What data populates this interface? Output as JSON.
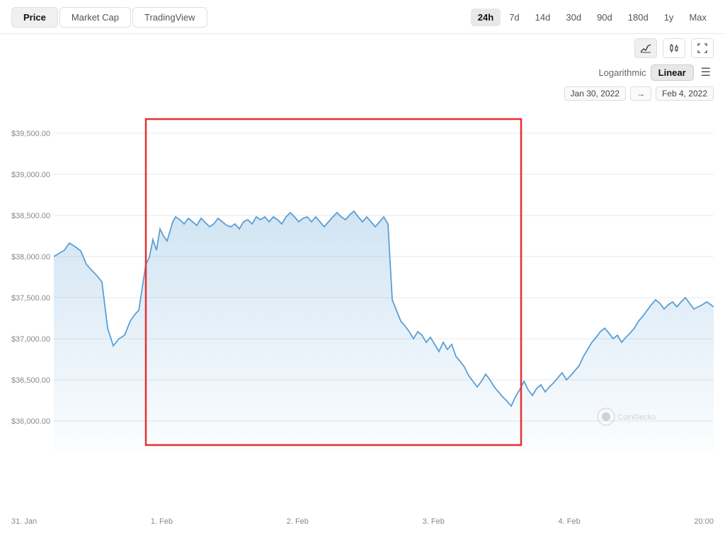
{
  "tabs": [
    {
      "label": "Price",
      "active": true
    },
    {
      "label": "Market Cap",
      "active": false
    },
    {
      "label": "TradingView",
      "active": false
    }
  ],
  "time_buttons": [
    {
      "label": "24h",
      "active": true
    },
    {
      "label": "7d",
      "active": false
    },
    {
      "label": "14d",
      "active": false
    },
    {
      "label": "30d",
      "active": false
    },
    {
      "label": "90d",
      "active": false
    },
    {
      "label": "180d",
      "active": false
    },
    {
      "label": "1y",
      "active": false
    },
    {
      "label": "Max",
      "active": false
    }
  ],
  "chart_controls": [
    {
      "icon": "📈",
      "name": "line-chart-btn",
      "active": true
    },
    {
      "icon": "🕯",
      "name": "candle-chart-btn",
      "active": false
    },
    {
      "icon": "⛶",
      "name": "fullscreen-btn",
      "active": false
    }
  ],
  "scale": {
    "logarithmic_label": "Logarithmic",
    "linear_label": "Linear"
  },
  "date_range": {
    "from": "Jan 30, 2022",
    "arrow": "→",
    "to": "Feb 4, 2022"
  },
  "y_labels": [
    "$39,500.00",
    "$39,000.00",
    "$38,500.00",
    "$38,000.00",
    "$37,500.00",
    "$37,000.00",
    "$36,500.00",
    "$36,000.00"
  ],
  "x_labels": [
    "31. Jan",
    "1. Feb",
    "2. Feb",
    "3. Feb",
    "4. Feb",
    "20:00"
  ],
  "watermark": "CoinGecko",
  "colors": {
    "line": "#5b9fd4",
    "fill_start": "rgba(91,159,212,0.25)",
    "fill_end": "rgba(91,159,212,0.02)",
    "grid": "#f0f0f0",
    "red_box": "#e53030"
  }
}
